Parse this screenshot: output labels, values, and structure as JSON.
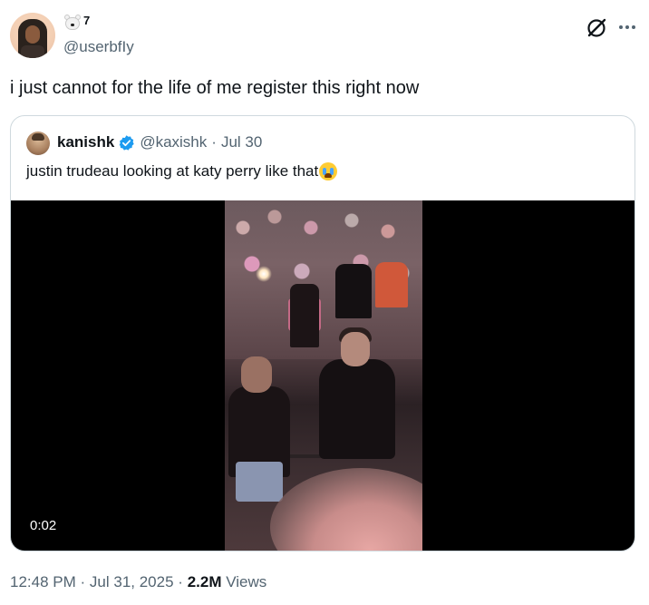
{
  "author": {
    "name_suffix": "7",
    "handle": "@userbfIy"
  },
  "tweet": {
    "text": "i just cannot for the life of me register this right now"
  },
  "quoted": {
    "name": "kanishk",
    "handle": "@kaxishk",
    "separator": "·",
    "date": "Jul 30",
    "text": "justin trudeau looking at katy perry like that",
    "video_time": "0:02"
  },
  "meta": {
    "time": "12:48 PM",
    "sep1": "·",
    "date": "Jul 31, 2025",
    "sep2": "·",
    "views_count": "2.2M",
    "views_label": "Views"
  },
  "icons": {
    "name_emoji": "polar-bear-face",
    "quote_emoji": "loudly-crying-face",
    "grok": "grok-icon",
    "more": "more-icon",
    "verified": "verified-badge-icon"
  },
  "colors": {
    "text_primary": "#0f1419",
    "text_secondary": "#536471",
    "verified_blue": "#1d9bf0",
    "border": "#cfd9de"
  }
}
